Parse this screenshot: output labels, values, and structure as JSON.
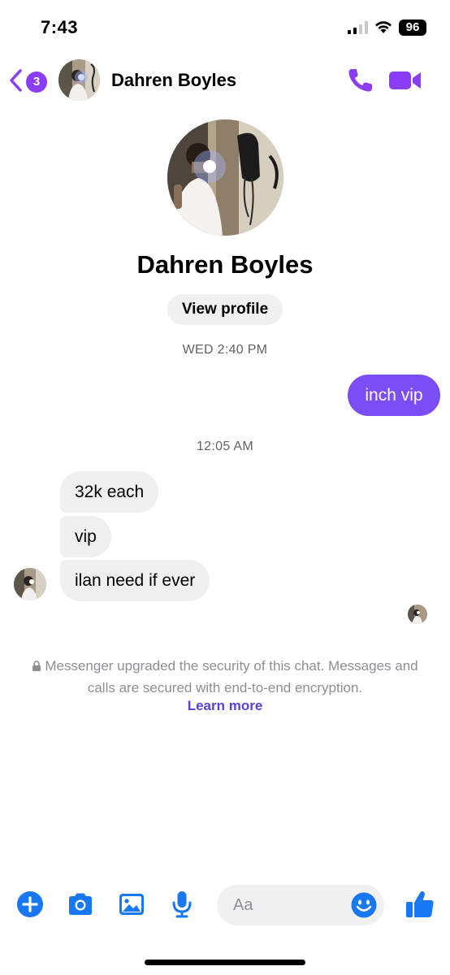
{
  "status_bar": {
    "time": "7:43",
    "battery": "96"
  },
  "header": {
    "unread_count": "3",
    "contact_name": "Dahren Boyles"
  },
  "profile": {
    "name": "Dahren Boyles",
    "view_profile_label": "View profile"
  },
  "messages": {
    "timestamp_1": "WED 2:40 PM",
    "outgoing_1": "inch vip",
    "timestamp_2": "12:05 AM",
    "incoming": [
      "32k each",
      "vip",
      "ilan need if ever"
    ]
  },
  "security_notice": {
    "text": "Messenger upgraded the security of this chat. Messages and calls are secured with end-to-end encryption.",
    "learn_more": "Learn more"
  },
  "composer": {
    "placeholder": "Aa"
  },
  "colors": {
    "accent": "#8a3df5",
    "outgoing_bubble": "#7b4df4",
    "action_blue": "#1877f2",
    "link": "#5b3fd9"
  },
  "icons": [
    "back-chevron-icon",
    "phone-icon",
    "video-camera-icon",
    "lock-icon",
    "plus-icon",
    "camera-icon",
    "photo-icon",
    "microphone-icon",
    "emoji-icon",
    "thumbs-up-icon"
  ]
}
